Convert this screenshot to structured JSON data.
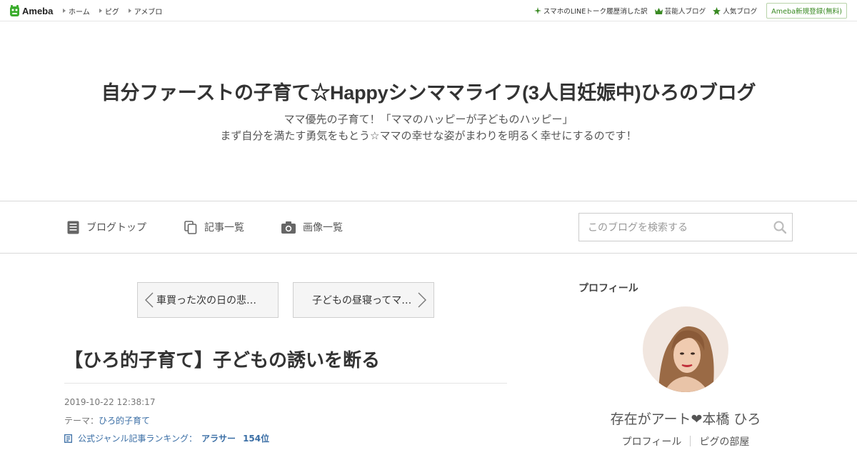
{
  "header": {
    "logo_text": "Ameba",
    "nav_left": [
      "ホーム",
      "ピグ",
      "アメブロ"
    ],
    "nav_right": [
      "スマホのLINEトーク履歴消した訳",
      "芸能人ブログ",
      "人気ブログ"
    ],
    "signup_label": "Ameba新規登録(無料)"
  },
  "blog": {
    "title": "自分ファーストの子育て☆Happyシンママライフ(3人目妊娠中)ひろのブログ",
    "description_line1": "ママ優先の子育て！「ママのハッピーが子どものハッピー」",
    "description_line2": "まず自分を満たす勇気をもとう☆ママの幸せな姿がまわりを明るく幸せにするのです！"
  },
  "blognav": {
    "items": [
      "ブログトップ",
      "記事一覧",
      "画像一覧"
    ],
    "search_placeholder": "このブログを検索する"
  },
  "pager": {
    "prev_label": "車買った次の日の悲…",
    "next_label": "子どもの昼寝ってマ…"
  },
  "article": {
    "title": "【ひろ的子育て】子どもの誘いを断る",
    "date": "2019-10-22 12:38:17",
    "theme_prefix": "テーマ：",
    "theme": "ひろ的子育て",
    "ranking_label": "公式ジャンル記事ランキング：",
    "ranking_genre": "アラサー",
    "ranking_position": "154位"
  },
  "sidebar": {
    "heading": "プロフィール",
    "profile_name": "存在がアート❤本橋 ひろ",
    "links": [
      "プロフィール",
      "ピグの部屋"
    ]
  },
  "colors": {
    "accent_green": "#3a8a23",
    "link_blue": "#3a6ea5",
    "border": "#d9d9d9"
  }
}
